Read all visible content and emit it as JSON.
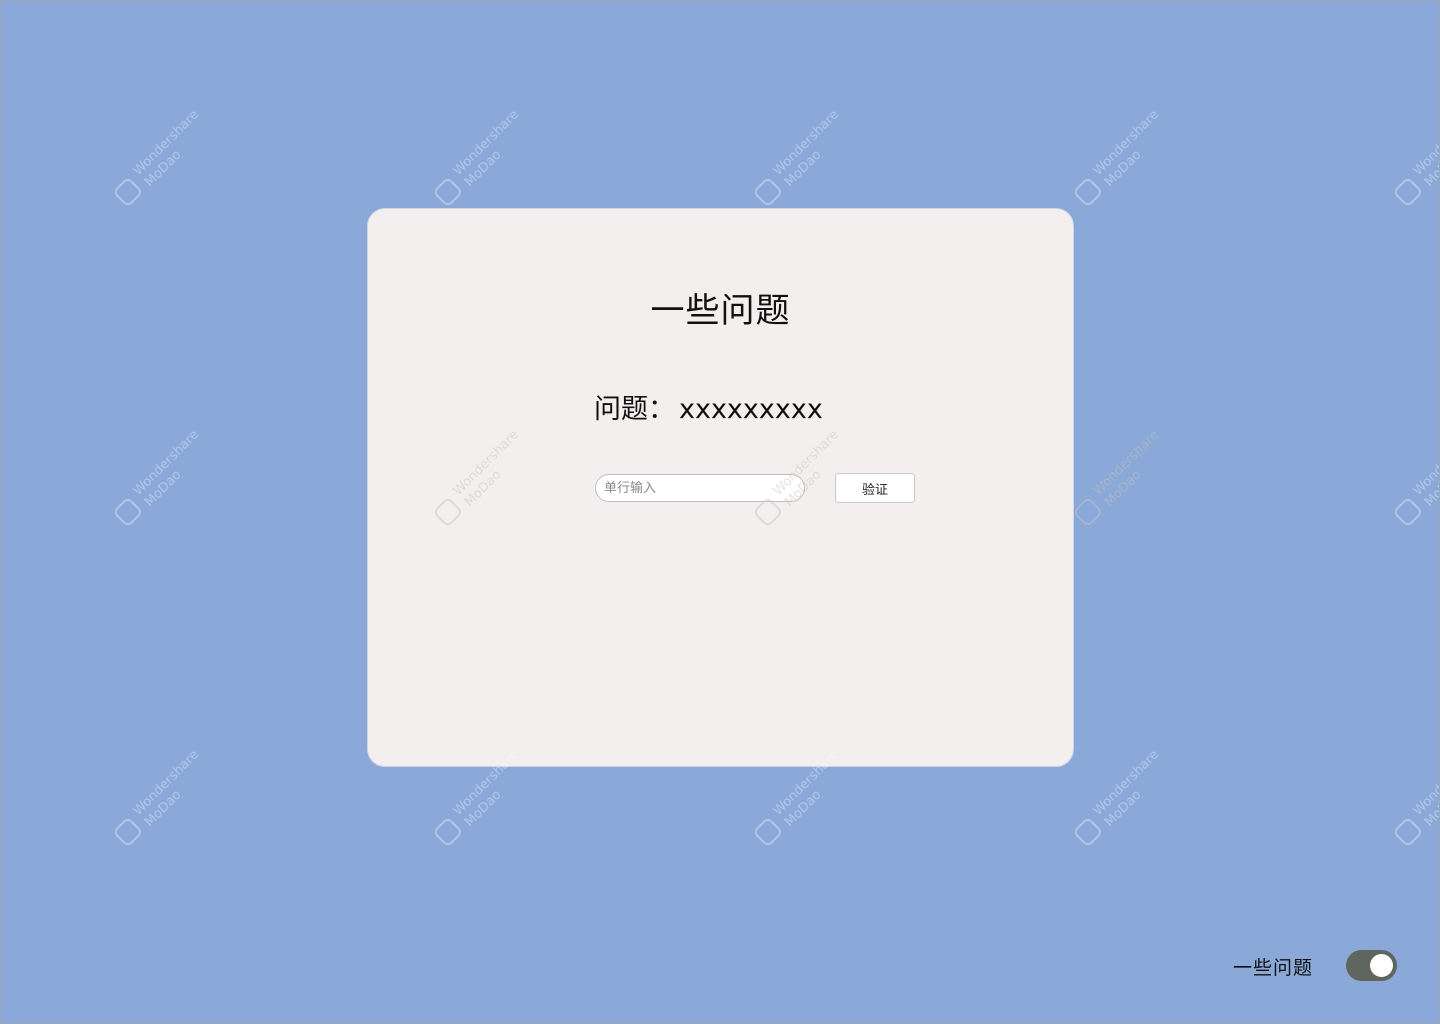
{
  "card": {
    "title": "一些问题",
    "question_label": "问题：",
    "question_value": "xxxxxxxxx",
    "input_placeholder": "单行输入",
    "input_value": "",
    "verify_label": "验证"
  },
  "footer": {
    "label": "一些问题",
    "toggle_on": true
  },
  "watermark": {
    "line1": "Wondershare",
    "line2": "MoDao"
  },
  "colors": {
    "background": "#8aa8d8",
    "card": "#f2efee",
    "toggle_track": "#5e665f"
  }
}
